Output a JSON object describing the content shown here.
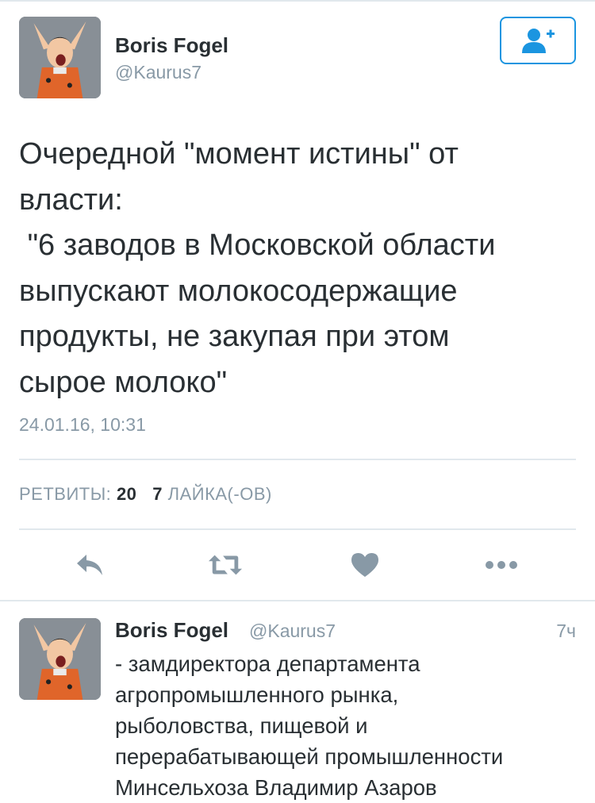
{
  "tweet": {
    "author_name": "Boris Fogel",
    "author_handle": "@Kaurus7",
    "text": "Очередной \"момент истины\" от\nвласти:\n \"6 заводов в Московской области\nвыпускают молокосодержащие\nпродукты, не закупая при этом\nсырое молоко\"",
    "timestamp": "24.01.16, 10:31",
    "retweets_label": "РЕТВИТЫ:",
    "retweets_count": "20",
    "likes_count": "7",
    "likes_label": "ЛАЙКА(-ОВ)"
  },
  "actions": {
    "reply_icon": "reply-icon",
    "retweet_icon": "retweet-icon",
    "like_icon": "heart-icon",
    "more_icon": "more-icon"
  },
  "follow_button": {
    "icon": "add-user-icon",
    "color": "#1b95e0"
  },
  "reply": {
    "author_name": "Boris Fogel",
    "author_handle": "@Kaurus7",
    "time": "7ч",
    "text": "- замдиректора департамента\nагропромышленного рынка,\nрыболовства, пищевой и\nперерабатывающей промышленности\nМинсельхоза Владимир Азаров"
  },
  "colors": {
    "text": "#292f33",
    "secondary": "#8899a6",
    "accent": "#1b95e0",
    "icon": "#8899a6",
    "divider": "#e1e8ed"
  }
}
